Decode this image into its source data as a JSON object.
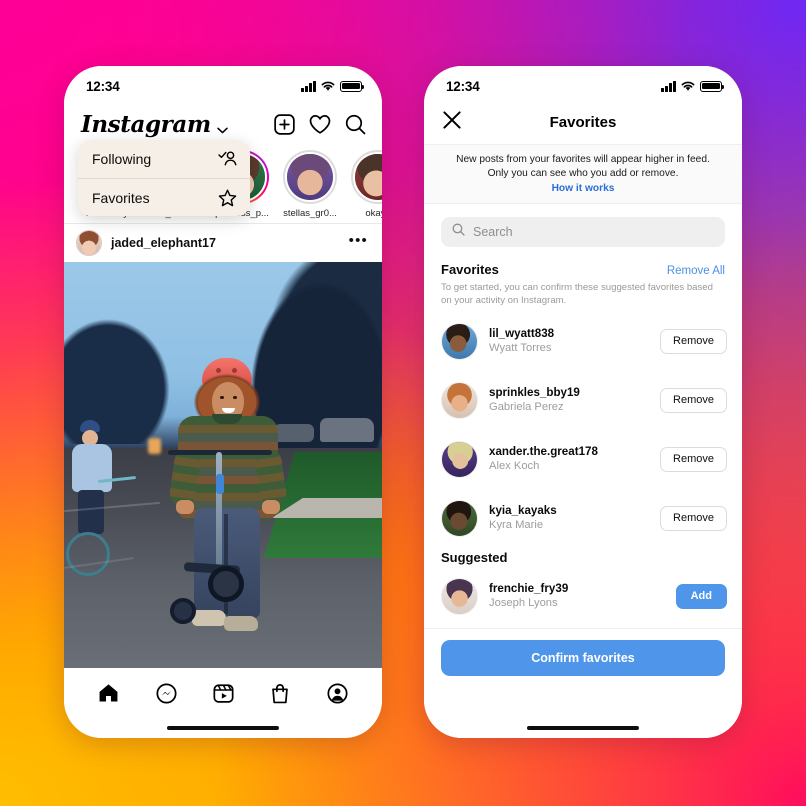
{
  "background": {
    "gradient_colors": [
      "#FF0096",
      "#FF1452",
      "#FF6A00",
      "#FFC300",
      "#6E28F5",
      "#FF0C5C"
    ]
  },
  "left_phone": {
    "status_bar": {
      "time": "12:34",
      "cell_icon": "cellular-signal-icon",
      "wifi_icon": "wifi-icon",
      "battery_icon": "battery-full-icon"
    },
    "header": {
      "logo": "Instagram",
      "chevron_icon": "chevron-down-icon",
      "actions": [
        {
          "name": "new-post-button",
          "icon": "plus-square-icon"
        },
        {
          "name": "activity-button",
          "icon": "heart-icon"
        },
        {
          "name": "search-button",
          "icon": "magnifier-icon"
        }
      ]
    },
    "dropdown": {
      "items": [
        {
          "label": "Following",
          "icon": "person-check-icon"
        },
        {
          "label": "Favorites",
          "icon": "star-outline-icon"
        }
      ]
    },
    "stories": [
      {
        "name": "Your Story",
        "ring": "plain"
      },
      {
        "name": "liam_bean...",
        "ring": "gradient"
      },
      {
        "name": "princess_p...",
        "ring": "gradient"
      },
      {
        "name": "stellas_gr0...",
        "ring": "plain"
      },
      {
        "name": "okay_",
        "ring": "plain"
      }
    ],
    "post": {
      "username": "jaded_elephant17",
      "more_icon": "ellipsis-icon",
      "image_alt": "Person in red helmet riding a scooter down a street at dusk with a cyclist behind"
    },
    "tabbar": [
      {
        "name": "tab-home",
        "icon": "home-icon"
      },
      {
        "name": "tab-messages",
        "icon": "messenger-icon"
      },
      {
        "name": "tab-reels",
        "icon": "reels-icon"
      },
      {
        "name": "tab-shop",
        "icon": "shop-bag-icon"
      },
      {
        "name": "tab-profile",
        "icon": "profile-circle-icon"
      }
    ]
  },
  "right_phone": {
    "status_bar": {
      "time": "12:34",
      "cell_icon": "cellular-signal-icon",
      "wifi_icon": "wifi-icon",
      "battery_icon": "battery-full-icon"
    },
    "header": {
      "title": "Favorites",
      "close_icon": "close-x-icon"
    },
    "note": {
      "line1": "New posts from your favorites will appear higher in feed.",
      "line2": "Only you can see who you add or remove.",
      "link": "How it works"
    },
    "search": {
      "placeholder": "Search",
      "icon": "search-icon"
    },
    "favorites_section": {
      "title": "Favorites",
      "action": "Remove All",
      "subtitle": "To get started, you can confirm these suggested favorites based on your activity on Instagram.",
      "rows": [
        {
          "username": "lil_wyatt838",
          "realname": "Wyatt Torres",
          "button": "Remove"
        },
        {
          "username": "sprinkles_bby19",
          "realname": "Gabriela Perez",
          "button": "Remove"
        },
        {
          "username": "xander.the.great178",
          "realname": "Alex Koch",
          "button": "Remove"
        },
        {
          "username": "kyia_kayaks",
          "realname": "Kyra Marie",
          "button": "Remove"
        }
      ]
    },
    "suggested_section": {
      "title": "Suggested",
      "rows": [
        {
          "username": "frenchie_fry39",
          "realname": "Joseph Lyons",
          "button": "Add"
        }
      ]
    },
    "confirm_button": "Confirm favorites",
    "accent_color": "#4F96EB",
    "link_color": "#4A90E2"
  }
}
